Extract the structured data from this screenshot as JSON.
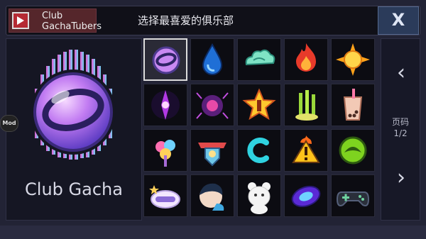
{
  "header": {
    "club_name": "Club GachaTubers",
    "title": "选择最喜爱的俱乐部",
    "close_label": "X"
  },
  "left_panel": {
    "club_label": "Club Gacha"
  },
  "nav": {
    "prev_label": "‹",
    "next_label": "›",
    "page_label": "页码",
    "page_number": "1/2"
  },
  "mod_badge": "Mod",
  "icons": [
    {
      "name": "gacha-orb-icon"
    },
    {
      "name": "water-drop-icon"
    },
    {
      "name": "cloud-icon"
    },
    {
      "name": "fire-icon"
    },
    {
      "name": "sun-icon"
    },
    {
      "name": "mystic-eye-icon"
    },
    {
      "name": "spider-skull-icon"
    },
    {
      "name": "star-number-one-icon"
    },
    {
      "name": "plant-sprouts-icon"
    },
    {
      "name": "bubble-tea-icon"
    },
    {
      "name": "candy-flower-icon"
    },
    {
      "name": "crest-shield-icon"
    },
    {
      "name": "letter-c-icon"
    },
    {
      "name": "warning-sign-icon"
    },
    {
      "name": "green-dragon-icon"
    },
    {
      "name": "sleep-mask-icon"
    },
    {
      "name": "character-head-icon"
    },
    {
      "name": "bear-icon"
    },
    {
      "name": "blue-gem-icon"
    },
    {
      "name": "gamepad-icon"
    }
  ],
  "colors": {
    "accent": "#b52a34",
    "panel": "#151623",
    "close_button": "#2b3b5a"
  }
}
